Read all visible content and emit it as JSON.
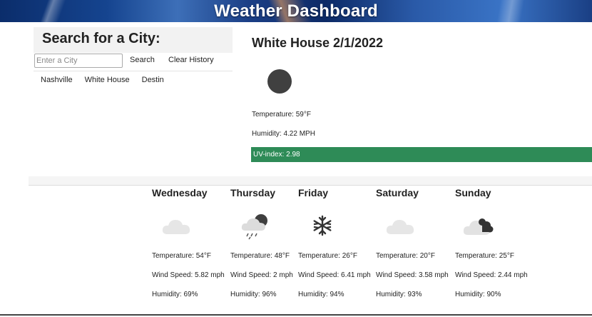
{
  "header": {
    "title": "Weather Dashboard"
  },
  "search": {
    "heading": "Search for a City:",
    "placeholder": "Enter a City",
    "search_label": "Search",
    "clear_label": "Clear History",
    "history": [
      "Nashville",
      "White House",
      "Destin"
    ]
  },
  "current": {
    "title": "White House 2/1/2022",
    "icon": "dark-circle-icon",
    "temperature": "Temperature: 59°F",
    "humidity": "Humidity: 4.22 MPH",
    "uv": "UV-index: 2.98",
    "uv_color": "#2e8b57"
  },
  "forecast": [
    {
      "day": "Wednesday",
      "icon": "cloud-icon",
      "temp": "Temperature: 54°F",
      "wind": "Wind Speed: 5.82 mph",
      "humidity": "Humidity: 69%"
    },
    {
      "day": "Thursday",
      "icon": "rain-cloud-icon",
      "temp": "Temperature: 48°F",
      "wind": "Wind Speed: 2 mph",
      "humidity": "Humidity: 96%"
    },
    {
      "day": "Friday",
      "icon": "snowflake-icon",
      "temp": "Temperature: 26°F",
      "wind": "Wind Speed: 6.41 mph",
      "humidity": "Humidity: 94%"
    },
    {
      "day": "Saturday",
      "icon": "cloud-icon",
      "temp": "Temperature: 20°F",
      "wind": "Wind Speed: 3.58 mph",
      "humidity": "Humidity: 93%"
    },
    {
      "day": "Sunday",
      "icon": "broken-clouds-icon",
      "temp": "Temperature: 25°F",
      "wind": "Wind Speed: 2.44 mph",
      "humidity": "Humidity: 90%"
    }
  ]
}
